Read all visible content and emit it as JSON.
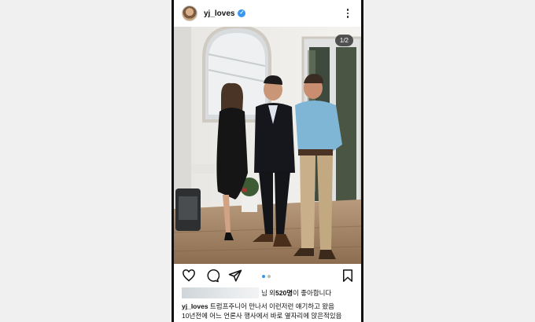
{
  "post": {
    "username": "yj_loves",
    "verified_badge": "✓",
    "photo_counter": "1/2",
    "likes_prefix": "님 외 ",
    "likes_count": "520명",
    "likes_suffix": "이 좋아합니다",
    "caption_username": "yj_loves",
    "caption_line1": " 트럼프주니어 만나서 이런저런 얘기하고 왔음",
    "caption_line2": "10년전에 어느 언론사 행사에서 바로 옆자리에 앉은적있음"
  },
  "icons": {
    "more": "more-vertical-icon",
    "like": "heart-icon",
    "comment": "comment-bubble-icon",
    "share": "send-paper-plane-icon",
    "save": "bookmark-icon"
  },
  "carousel": {
    "total": 2,
    "current": 1
  },
  "colors": {
    "accent": "#3897f0",
    "text": "#111111",
    "background": "#f0f0f0"
  }
}
